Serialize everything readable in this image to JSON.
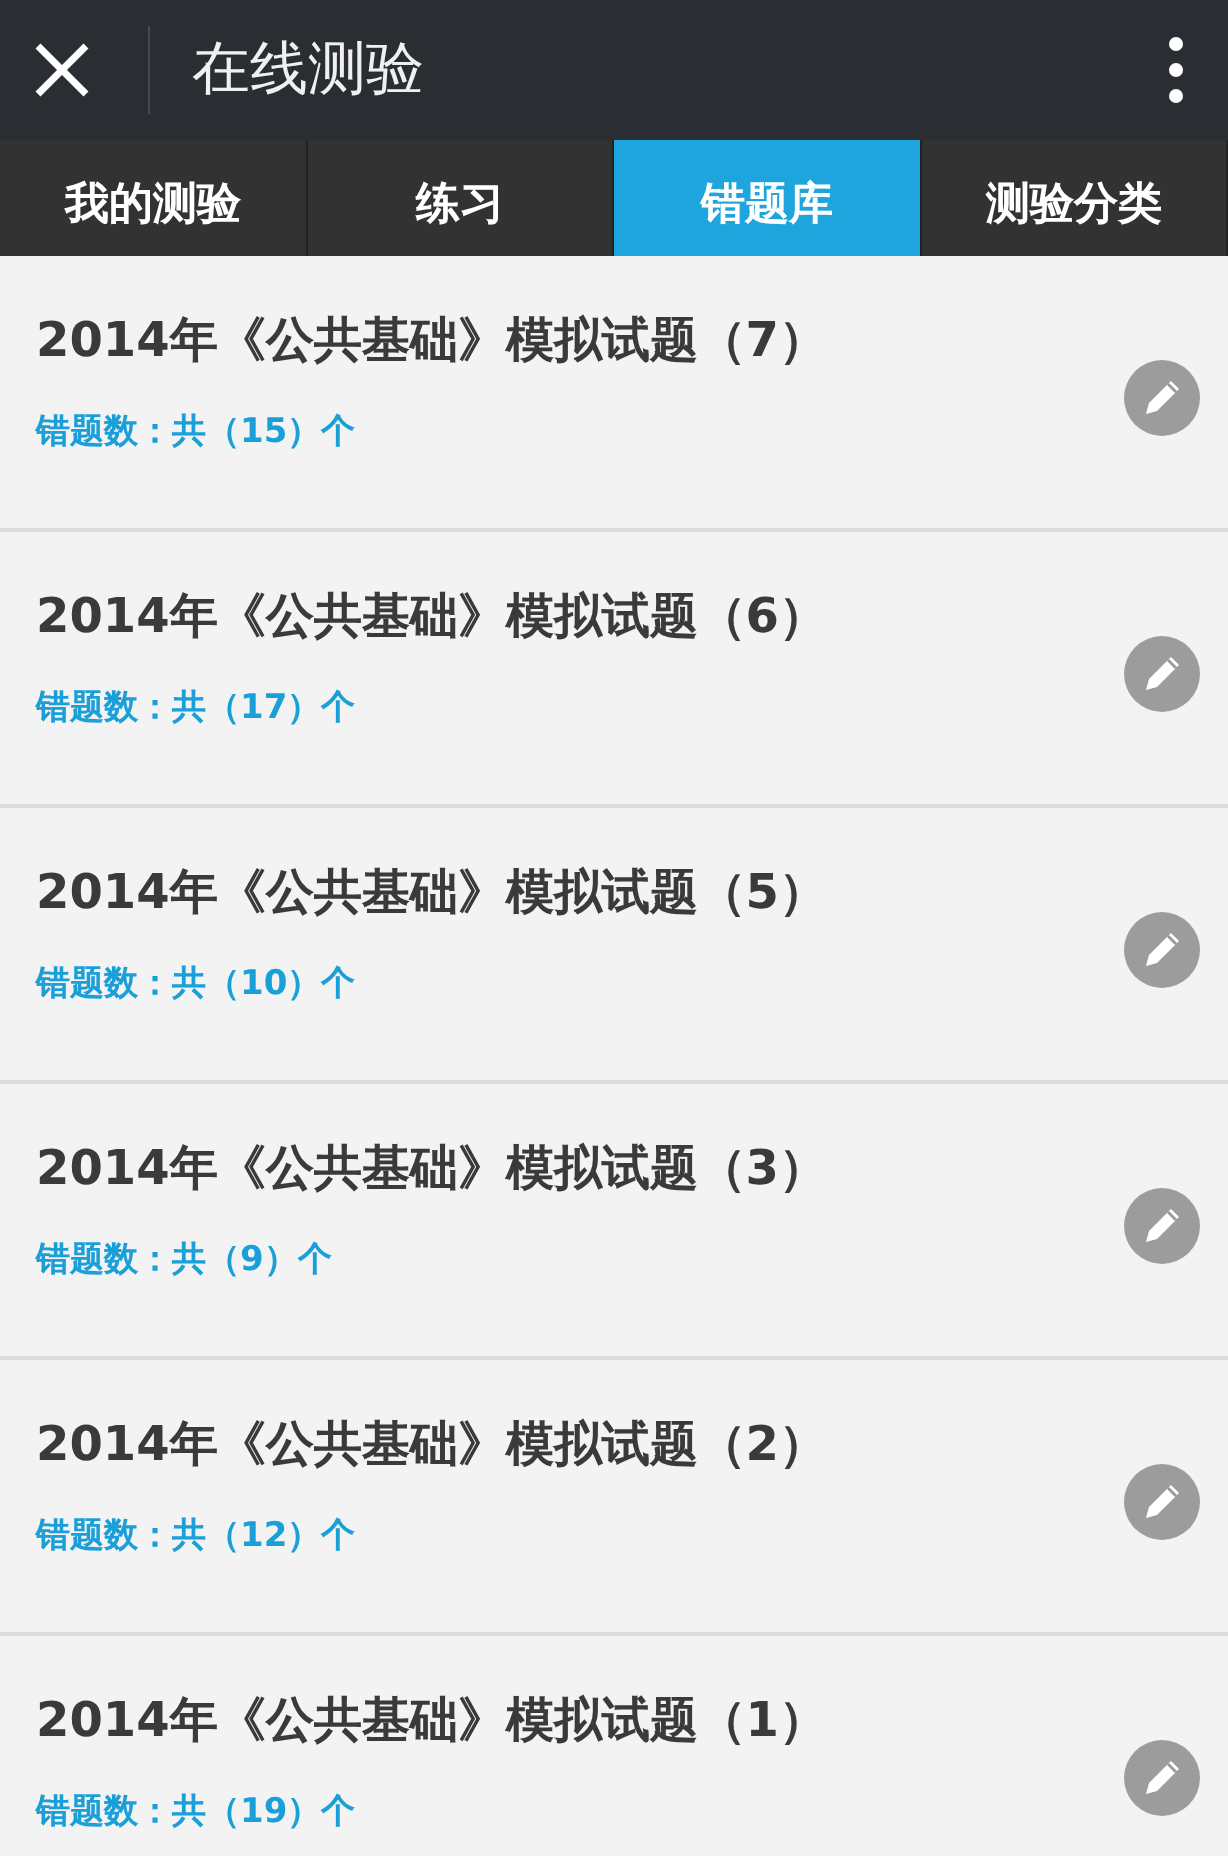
{
  "header": {
    "title": "在线测验"
  },
  "tabs": [
    {
      "label": "我的测验",
      "selected": false
    },
    {
      "label": "练习",
      "selected": false
    },
    {
      "label": "错题库",
      "selected": true
    },
    {
      "label": "测验分类",
      "selected": false
    }
  ],
  "items": [
    {
      "title": "2014年《公共基础》模拟试题（7）",
      "count": "错题数：共（15）个"
    },
    {
      "title": "2014年《公共基础》模拟试题（6）",
      "count": "错题数：共（17）个"
    },
    {
      "title": "2014年《公共基础》模拟试题（5）",
      "count": "错题数：共（10）个"
    },
    {
      "title": "2014年《公共基础》模拟试题（3）",
      "count": "错题数：共（9）个"
    },
    {
      "title": "2014年《公共基础》模拟试题（2）",
      "count": "错题数：共（12）个"
    },
    {
      "title": "2014年《公共基础》模拟试题（1）",
      "count": "错题数：共（19）个"
    }
  ]
}
